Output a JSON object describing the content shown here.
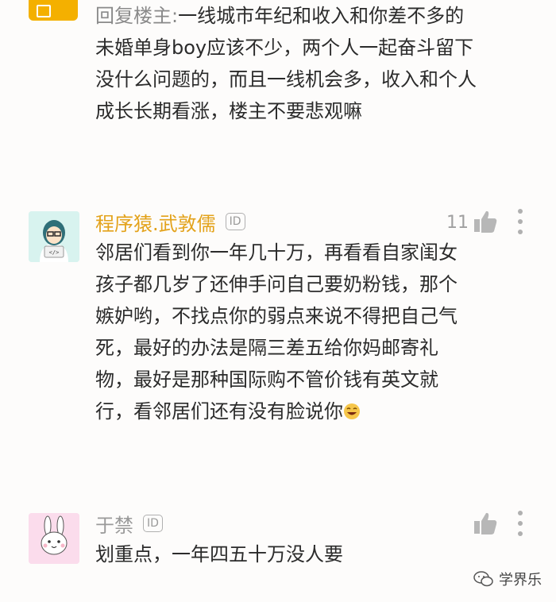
{
  "top_reply": {
    "prefix": "回复楼主:",
    "text": "一线城市年纪和收入和你差不多的未婚单身boy应该不少，两个人一起奋斗留下没什么问题的，而且一线机会多，收入和个人成长长期看涨，楼主不要悲观嘛"
  },
  "comments": [
    {
      "author": "程序猿.武敦儒",
      "id_badge": "ID",
      "likes": "11",
      "text": "邻居们看到你一年几十万，再看看自家闺女孩子都几岁了还伸手问自己要奶粉钱，那个嫉妒哟，不找点你的弱点来说不得把自己气死，最好的办法是隔三差五给你妈邮寄礼物，最好是那种国际购不管价钱有英文就行，看邻居们还有没有脸说你",
      "author_color": "#e3a21a"
    },
    {
      "author": "于禁",
      "id_badge": "ID",
      "likes": "",
      "text": "划重点，一年四五十万没人要",
      "author_color": "#9a9a9a"
    }
  ],
  "watermark": "学界乐",
  "icons": [
    "reply-tag-icon",
    "avatar-programmer",
    "thumbs-up-icon",
    "more-vertical-icon",
    "avatar-rabbit",
    "laughing-emoji",
    "wechat-icon"
  ]
}
